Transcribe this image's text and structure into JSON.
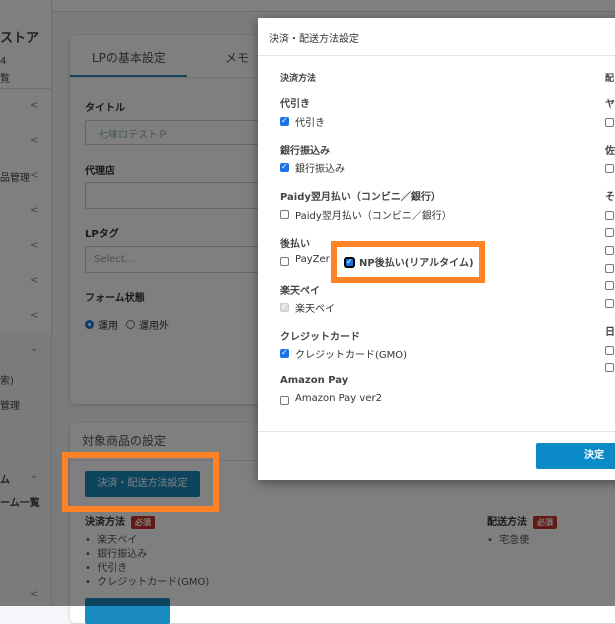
{
  "sidebar": {
    "brand_fragment": "ストア",
    "sub1": "4",
    "sub2": "覧",
    "item_manage": "品管理",
    "item_search": "索)",
    "item_manage2": "管理",
    "group_form": "ム",
    "item_form_list": "ーム一覧"
  },
  "card1": {
    "tabs": [
      "LPの基本設定",
      "メモ"
    ],
    "title_label": "タイトル",
    "title_value": "七味ロテストＰ",
    "agency_label": "代理店",
    "agency_value": "",
    "lptag_label": "LPタグ",
    "lptag_placeholder": "Select...",
    "form_status_label": "フォーム状態",
    "radio_options": [
      "運用",
      "運用外"
    ],
    "radio_selected": "運用"
  },
  "card2": {
    "title": "対象商品の設定",
    "settings_button": "決済・配送方法設定",
    "payment_label": "決済方法",
    "required_badge": "必須",
    "payment_items": [
      "楽天ペイ",
      "銀行振込み",
      "代引き",
      "クレジットカード(GMO)"
    ],
    "shipping_label": "配送方法",
    "shipping_items": [
      "宅急便"
    ]
  },
  "dialog": {
    "title": "決済・配送方法設定",
    "payment_header": "決済方法",
    "groups": [
      {
        "label": "代引き",
        "options": [
          {
            "label": "代引き",
            "checked": true
          }
        ]
      },
      {
        "label": "銀行振込み",
        "options": [
          {
            "label": "銀行振込み",
            "checked": true
          }
        ]
      },
      {
        "label": "Paidy翌月払い（コンビニ／銀行）",
        "options": [
          {
            "label": "Paidy翌月払い（コンビニ／銀行）",
            "checked": false
          }
        ]
      },
      {
        "label": "後払い",
        "options": [
          {
            "label": "PayZer",
            "checked": false
          },
          {
            "label": "NP後払い(リアルタイム)",
            "checked": true
          }
        ]
      },
      {
        "label": "楽天ペイ",
        "options": [
          {
            "label": "楽天ペイ",
            "checked": true,
            "disabled": true
          }
        ]
      },
      {
        "label": "クレジットカード",
        "options": [
          {
            "label": "クレジットカード(GMO)",
            "checked": true
          }
        ]
      },
      {
        "label": "Amazon Pay",
        "options": [
          {
            "label": "Amazon Pay ver2",
            "checked": false
          }
        ]
      }
    ],
    "shipping_header": "配",
    "shipping_groups": [
      "ヤ",
      "佐",
      "そ",
      "日"
    ],
    "confirm_button": "決定"
  },
  "colors": {
    "highlight": "#ff8225",
    "primary": "#0b8ac8",
    "checkbox": "#1a73e8"
  }
}
